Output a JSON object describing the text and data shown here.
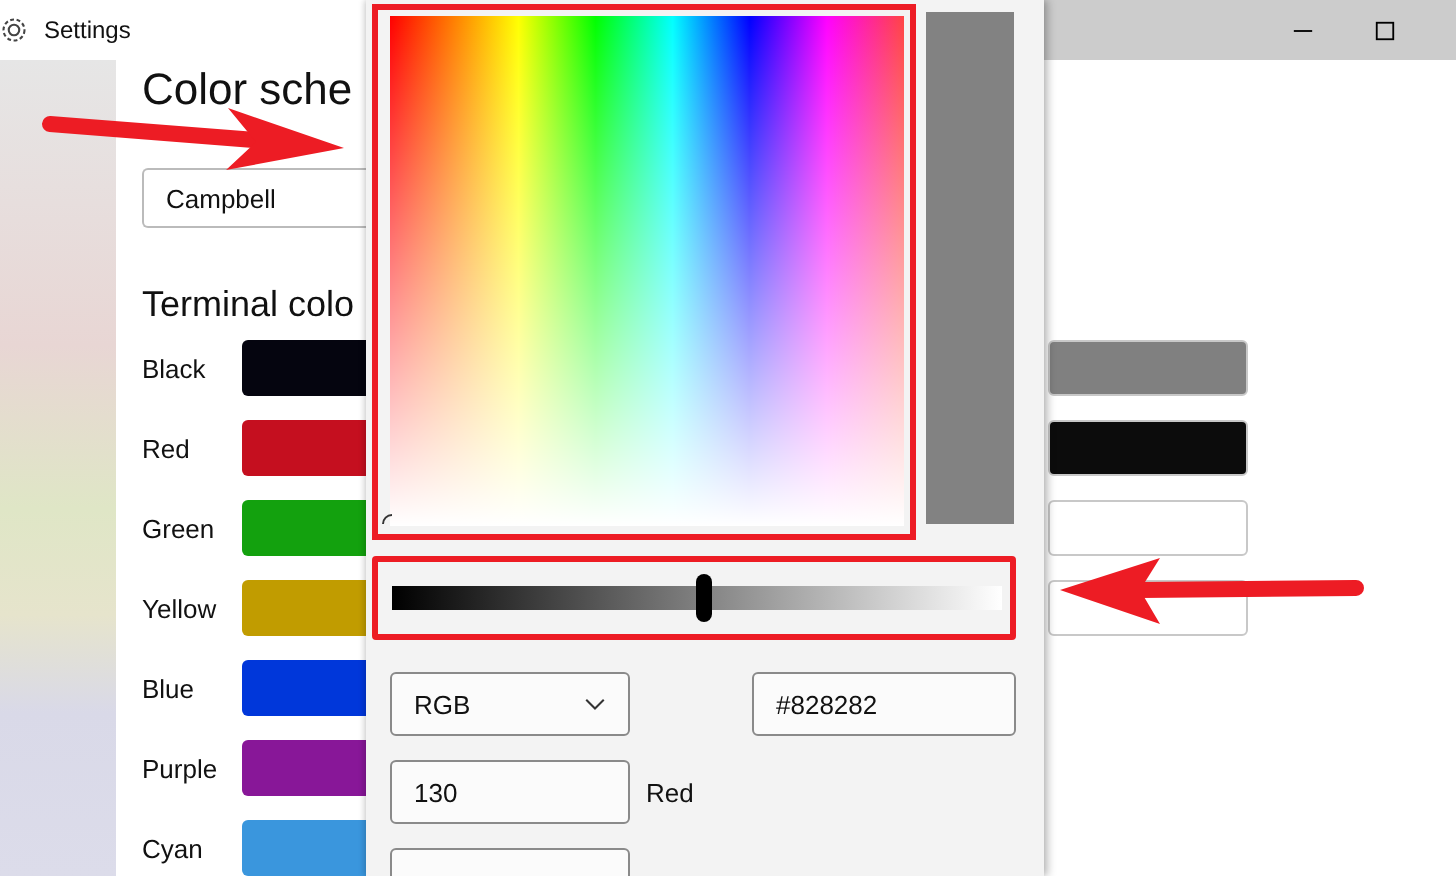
{
  "window": {
    "title": "Settings"
  },
  "page": {
    "heading": "Color sche",
    "scheme_dropdown": {
      "value": "Campbell"
    },
    "section_heading": "Terminal colo"
  },
  "colors": [
    {
      "name": "Black",
      "color": "#05050f"
    },
    {
      "name": "Red",
      "color": "#c50f1f"
    },
    {
      "name": "Green",
      "color": "#13a10e"
    },
    {
      "name": "Yellow",
      "color": "#c19c00"
    },
    {
      "name": "Blue",
      "color": "#0037da"
    },
    {
      "name": "Purple",
      "color": "#881798"
    },
    {
      "name": "Cyan",
      "color": "#3a96dd"
    }
  ],
  "bright_colors": [
    {
      "color": "#808080"
    },
    {
      "color": "#0c0c0c"
    },
    {
      "color": "#ffffff"
    },
    {
      "color": "#ffffff"
    }
  ],
  "color_picker": {
    "brightness": {
      "level": 0.51
    },
    "mode": "RGB",
    "hex_value": "#828282",
    "channels": [
      {
        "value": "130",
        "label": "Red"
      }
    ]
  }
}
